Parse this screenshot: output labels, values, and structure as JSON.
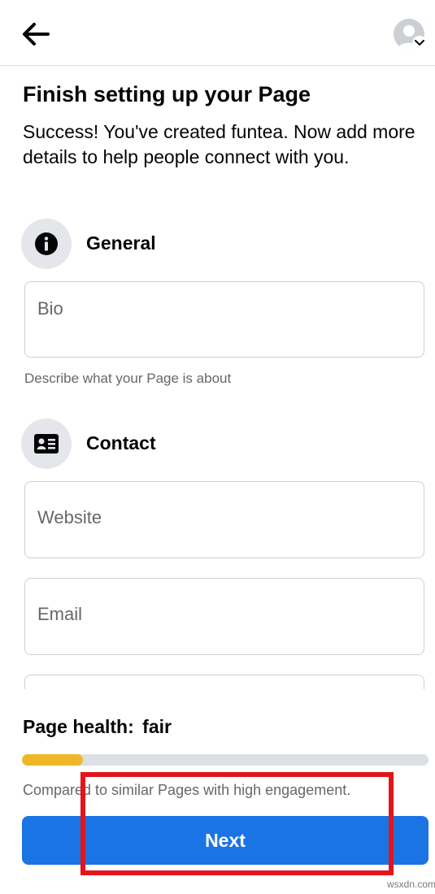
{
  "header": {
    "back_icon": "arrow-left-icon",
    "avatar_icon": "profile-avatar-icon",
    "avatar_menu_icon": "chevron-down-icon"
  },
  "page": {
    "title": "Finish setting up your Page",
    "subtitle": "Success! You've created funtea. Now add more details to help people connect with you."
  },
  "general": {
    "icon": "info-icon",
    "title": "General",
    "bio_placeholder": "Bio",
    "bio_helper": "Describe what your Page is about"
  },
  "contact": {
    "icon": "contact-card-icon",
    "title": "Contact",
    "website_placeholder": "Website",
    "email_placeholder": "Email"
  },
  "health": {
    "label": "Page health:",
    "value": "fair",
    "progress_fraction": 0.15,
    "comparison": "Compared to similar Pages with high engagement."
  },
  "next_button": {
    "label": "Next"
  },
  "colors": {
    "primary": "#1b74e4",
    "progress": "#f0b829",
    "highlight": "#e3151c"
  },
  "watermark": "wsxdn.com"
}
